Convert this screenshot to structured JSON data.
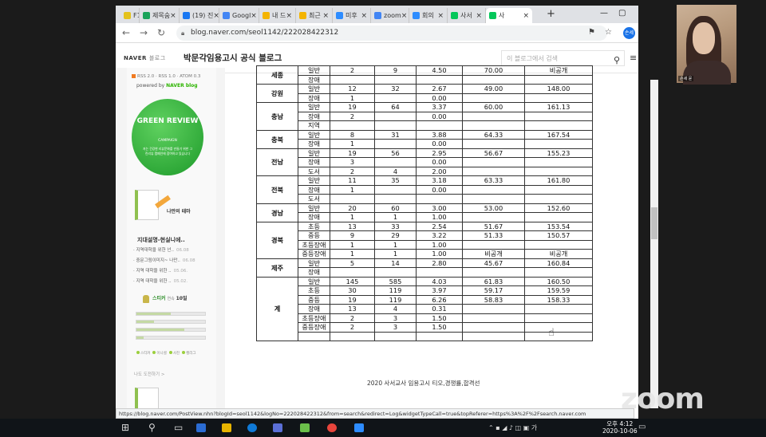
{
  "browser": {
    "tabs": [
      {
        "label": "F1",
        "color": "#e4c21b"
      },
      {
        "label": "제목숨",
        "color": "#1aa35b"
      },
      {
        "label": "(19) 진",
        "color": "#1877f2"
      },
      {
        "label": "Googl",
        "color": "#4285f4"
      },
      {
        "label": "내 드",
        "color": "#f4b400"
      },
      {
        "label": "최근",
        "color": "#f4b400"
      },
      {
        "label": "미후",
        "color": "#2d8cff"
      },
      {
        "label": "zoom",
        "color": "#4285f4"
      },
      {
        "label": "회의",
        "color": "#2d8cff"
      },
      {
        "label": "사서",
        "color": "#03c75a"
      },
      {
        "label": "사",
        "color": "#03c75a"
      }
    ],
    "url": "blog.naver.com/seol1142/222028422312",
    "profile_label": "손세",
    "status_url": "https://blog.naver.com/PostView.nhn?blogId=seol1142&logNo=222028422312&from=search&redirect=Log&widgetTypeCall=true&topReferer=https%3A%2F%2Fsearch.naver.com"
  },
  "naver": {
    "logo": "NAVER",
    "logo_sub": "블로그",
    "blog_title": "박문각임용고시 공식 블로그",
    "search_placeholder": "이 블로그에서 검색"
  },
  "sidebar": {
    "rss": "RSS 2.0 · RSS 1.0 · ATOM 0.3",
    "powered": "powered by",
    "powered_brand": "NAVER blog",
    "badge_title": "GREEN REVIEW",
    "badge_sub": "CAMPAIGN",
    "badge_msg": "저는 건강한 리뷰문화를 만들기 위한 그린리뷰 캠페인에 참여하고 있습니다",
    "theme_label": "나만의 테마",
    "recent_title": "지대설명-현실니에..",
    "recent_items": [
      {
        "text": "· 지역대학을 위한 넌..",
        "date": "06.08"
      },
      {
        "text": "· 중문그림이미지~ 나만..",
        "date": "06.08"
      },
      {
        "text": "· 지역 대학을 위한 ..",
        "date": "05.06."
      },
      {
        "text": "· 지역 대학을 위한 ..",
        "date": "05.02."
      }
    ],
    "sticker_label": "스티커",
    "sticker_count": "10일",
    "sticker_prefix": "연속",
    "legend": [
      "스티커",
      "이니셜",
      "사진",
      "캘리그"
    ],
    "more": "나도 도전하기 >",
    "sliders": [
      0.5,
      0.25,
      0.7,
      0.1
    ]
  },
  "table": {
    "rows": [
      {
        "region": "세종",
        "rowspan": 2,
        "cells": [
          "일반",
          "2",
          "9",
          "4.50",
          "70.00",
          "비공개"
        ]
      },
      {
        "cells": [
          "장애",
          "",
          "",
          "",
          "",
          ""
        ]
      },
      {
        "region": "강원",
        "rowspan": 2,
        "cells": [
          "일반",
          "12",
          "32",
          "2.67",
          "49.00",
          "148.00"
        ]
      },
      {
        "cells": [
          "장애",
          "1",
          "",
          "0.00",
          "",
          ""
        ]
      },
      {
        "region": "충남",
        "rowspan": 3,
        "cells": [
          "일반",
          "19",
          "64",
          "3.37",
          "60.00",
          "161.13"
        ]
      },
      {
        "cells": [
          "장애",
          "2",
          "",
          "0.00",
          "",
          ""
        ]
      },
      {
        "cells": [
          "지역",
          "",
          "",
          "",
          "",
          ""
        ]
      },
      {
        "region": "충북",
        "rowspan": 2,
        "cells": [
          "일반",
          "8",
          "31",
          "3.88",
          "64.33",
          "167.54"
        ]
      },
      {
        "cells": [
          "장애",
          "1",
          "",
          "0.00",
          "",
          ""
        ]
      },
      {
        "region": "전남",
        "rowspan": 3,
        "cells": [
          "일반",
          "19",
          "56",
          "2.95",
          "56.67",
          "155.23"
        ]
      },
      {
        "cells": [
          "장애",
          "3",
          "",
          "0.00",
          "",
          ""
        ]
      },
      {
        "cells": [
          "도서",
          "2",
          "4",
          "2.00",
          "",
          ""
        ]
      },
      {
        "region": "전북",
        "rowspan": 3,
        "cells": [
          "일반",
          "11",
          "35",
          "3.18",
          "63.33",
          "161.80"
        ]
      },
      {
        "cells": [
          "장애",
          "1",
          "",
          "0.00",
          "",
          ""
        ]
      },
      {
        "cells": [
          "도서",
          "",
          "",
          "",
          "",
          ""
        ]
      },
      {
        "region": "경남",
        "rowspan": 2,
        "cells": [
          "일반",
          "20",
          "60",
          "3.00",
          "53.00",
          "152.60"
        ]
      },
      {
        "cells": [
          "장애",
          "1",
          "1",
          "1.00",
          "",
          ""
        ]
      },
      {
        "region": "경북",
        "rowspan": 4,
        "cells": [
          "초등",
          "13",
          "33",
          "2.54",
          "51.67",
          "153.54"
        ]
      },
      {
        "cells": [
          "중등",
          "9",
          "29",
          "3.22",
          "51.33",
          "150.57"
        ]
      },
      {
        "cells": [
          "초등장애",
          "1",
          "1",
          "1.00",
          "",
          ""
        ]
      },
      {
        "cells": [
          "중등장애",
          "1",
          "1",
          "1.00",
          "비공개",
          "비공개"
        ]
      },
      {
        "region": "제주",
        "rowspan": 2,
        "cells": [
          "일반",
          "5",
          "14",
          "2.80",
          "45.67",
          "160.84"
        ]
      },
      {
        "cells": [
          "장애",
          "",
          "",
          "",
          "",
          ""
        ]
      },
      {
        "region": "계",
        "rowspan": 7,
        "cells": [
          "일반",
          "145",
          "585",
          "4.03",
          "61.83",
          "160.50"
        ]
      },
      {
        "cells": [
          "초등",
          "30",
          "119",
          "3.97",
          "59.17",
          "159.59"
        ]
      },
      {
        "cells": [
          "중등",
          "19",
          "119",
          "6.26",
          "58.83",
          "158.33"
        ]
      },
      {
        "cells": [
          "장애",
          "13",
          "4",
          "0.31",
          "",
          ""
        ]
      },
      {
        "cells": [
          "초등장애",
          "2",
          "3",
          "1.50",
          "",
          ""
        ]
      },
      {
        "cells": [
          "중등장애",
          "2",
          "3",
          "1.50",
          "",
          ""
        ]
      },
      {
        "cells": [
          "",
          "",
          "",
          "",
          "",
          ""
        ]
      }
    ],
    "caption": "2020 사서교사 임용고시 티오,경쟁률,합격선"
  },
  "zoom": {
    "watermark": "zoom",
    "participant_name": "손세 윤"
  },
  "taskbar": {
    "time": "오후 4:12",
    "date": "2020-10-06"
  }
}
